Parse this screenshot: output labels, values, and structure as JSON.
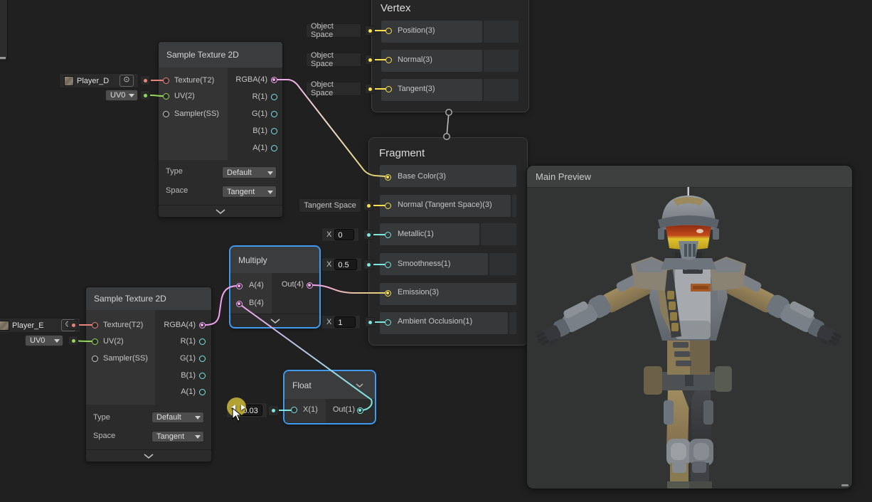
{
  "canvas": {
    "background": "#202020"
  },
  "colors": {
    "selection_blue": "#3E9BF0",
    "port_vector4_pink": "#F2A4EE",
    "port_vector3_yellow": "#F8E14C",
    "port_vector2_green": "#94D65A",
    "port_float_cyan": "#7CE8E0",
    "port_texture_red": "#E8837B",
    "port_sampler_gray": "#C8C8C8",
    "stack_edge_gray": "#BDBDBD"
  },
  "nodes": {
    "sample_texture_top": {
      "title": "Sample Texture 2D",
      "inputs": {
        "texture": "Texture(T2)",
        "uv": "UV(2)",
        "sampler": "Sampler(SS)"
      },
      "outputs": {
        "rgba": "RGBA(4)",
        "r": "R(1)",
        "g": "G(1)",
        "b": "B(1)",
        "a": "A(1)"
      },
      "type_label": "Type",
      "type_value": "Default",
      "space_label": "Space",
      "space_value": "Tangent"
    },
    "sample_texture_bottom": {
      "title": "Sample Texture 2D",
      "inputs": {
        "texture": "Texture(T2)",
        "uv": "UV(2)",
        "sampler": "Sampler(SS)"
      },
      "outputs": {
        "rgba": "RGBA(4)",
        "r": "R(1)",
        "g": "G(1)",
        "b": "B(1)",
        "a": "A(1)"
      },
      "type_label": "Type",
      "type_value": "Default",
      "space_label": "Space",
      "space_value": "Tangent"
    },
    "multiply": {
      "title": "Multiply",
      "inputs": {
        "a": "A(4)",
        "b": "B(4)"
      },
      "outputs": {
        "out": "Out(4)"
      }
    },
    "float_node": {
      "title": "Float",
      "inputs": {
        "x": "X(1)"
      },
      "outputs": {
        "out": "Out(1)"
      }
    },
    "vertex": {
      "title": "Vertex",
      "rows": {
        "position": "Position(3)",
        "normal": "Normal(3)",
        "tangent": "Tangent(3)"
      }
    },
    "fragment": {
      "title": "Fragment",
      "rows": {
        "base_color": "Base Color(3)",
        "normal": "Normal (Tangent Space)(3)",
        "metallic": "Metallic(1)",
        "smoothness": "Smoothness(1)",
        "emission": "Emission(3)",
        "ambient_occlusion": "Ambient Occlusion(1)"
      }
    }
  },
  "widgets": {
    "player_d_label": "Player_D",
    "player_e_label": "Player_E",
    "uv_channel": "UV0",
    "object_space_label": "Object Space",
    "tangent_space_label": "Tangent Space",
    "x_prefix": "X",
    "metallic_value": "0",
    "smoothness_value": "0.5",
    "ambient_occlusion_value": "1",
    "float_value": "0.03",
    "expose_icon": "⊙"
  },
  "preview": {
    "title": "Main Preview"
  }
}
